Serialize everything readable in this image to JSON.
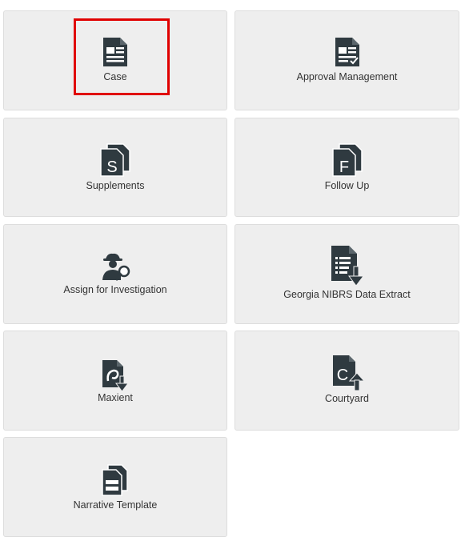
{
  "tiles": [
    {
      "label": "Case",
      "icon": "case-document-icon"
    },
    {
      "label": "Approval Management",
      "icon": "approval-document-icon"
    },
    {
      "label": "Supplements",
      "icon": "supplements-s-icon"
    },
    {
      "label": "Follow Up",
      "icon": "follow-up-f-icon"
    },
    {
      "label": "Assign for Investigation",
      "icon": "investigator-magnifier-icon"
    },
    {
      "label": "Georgia NIBRS Data Extract",
      "icon": "data-extract-download-icon"
    },
    {
      "label": "Maxient",
      "icon": "maxient-download-icon"
    },
    {
      "label": "Courtyard",
      "icon": "courtyard-c-upload-icon"
    },
    {
      "label": "Narrative Template",
      "icon": "narrative-template-icon"
    }
  ],
  "colors": {
    "tile_bg": "#eeeeee",
    "icon": "#2f3a40",
    "highlight": "#e00000"
  }
}
